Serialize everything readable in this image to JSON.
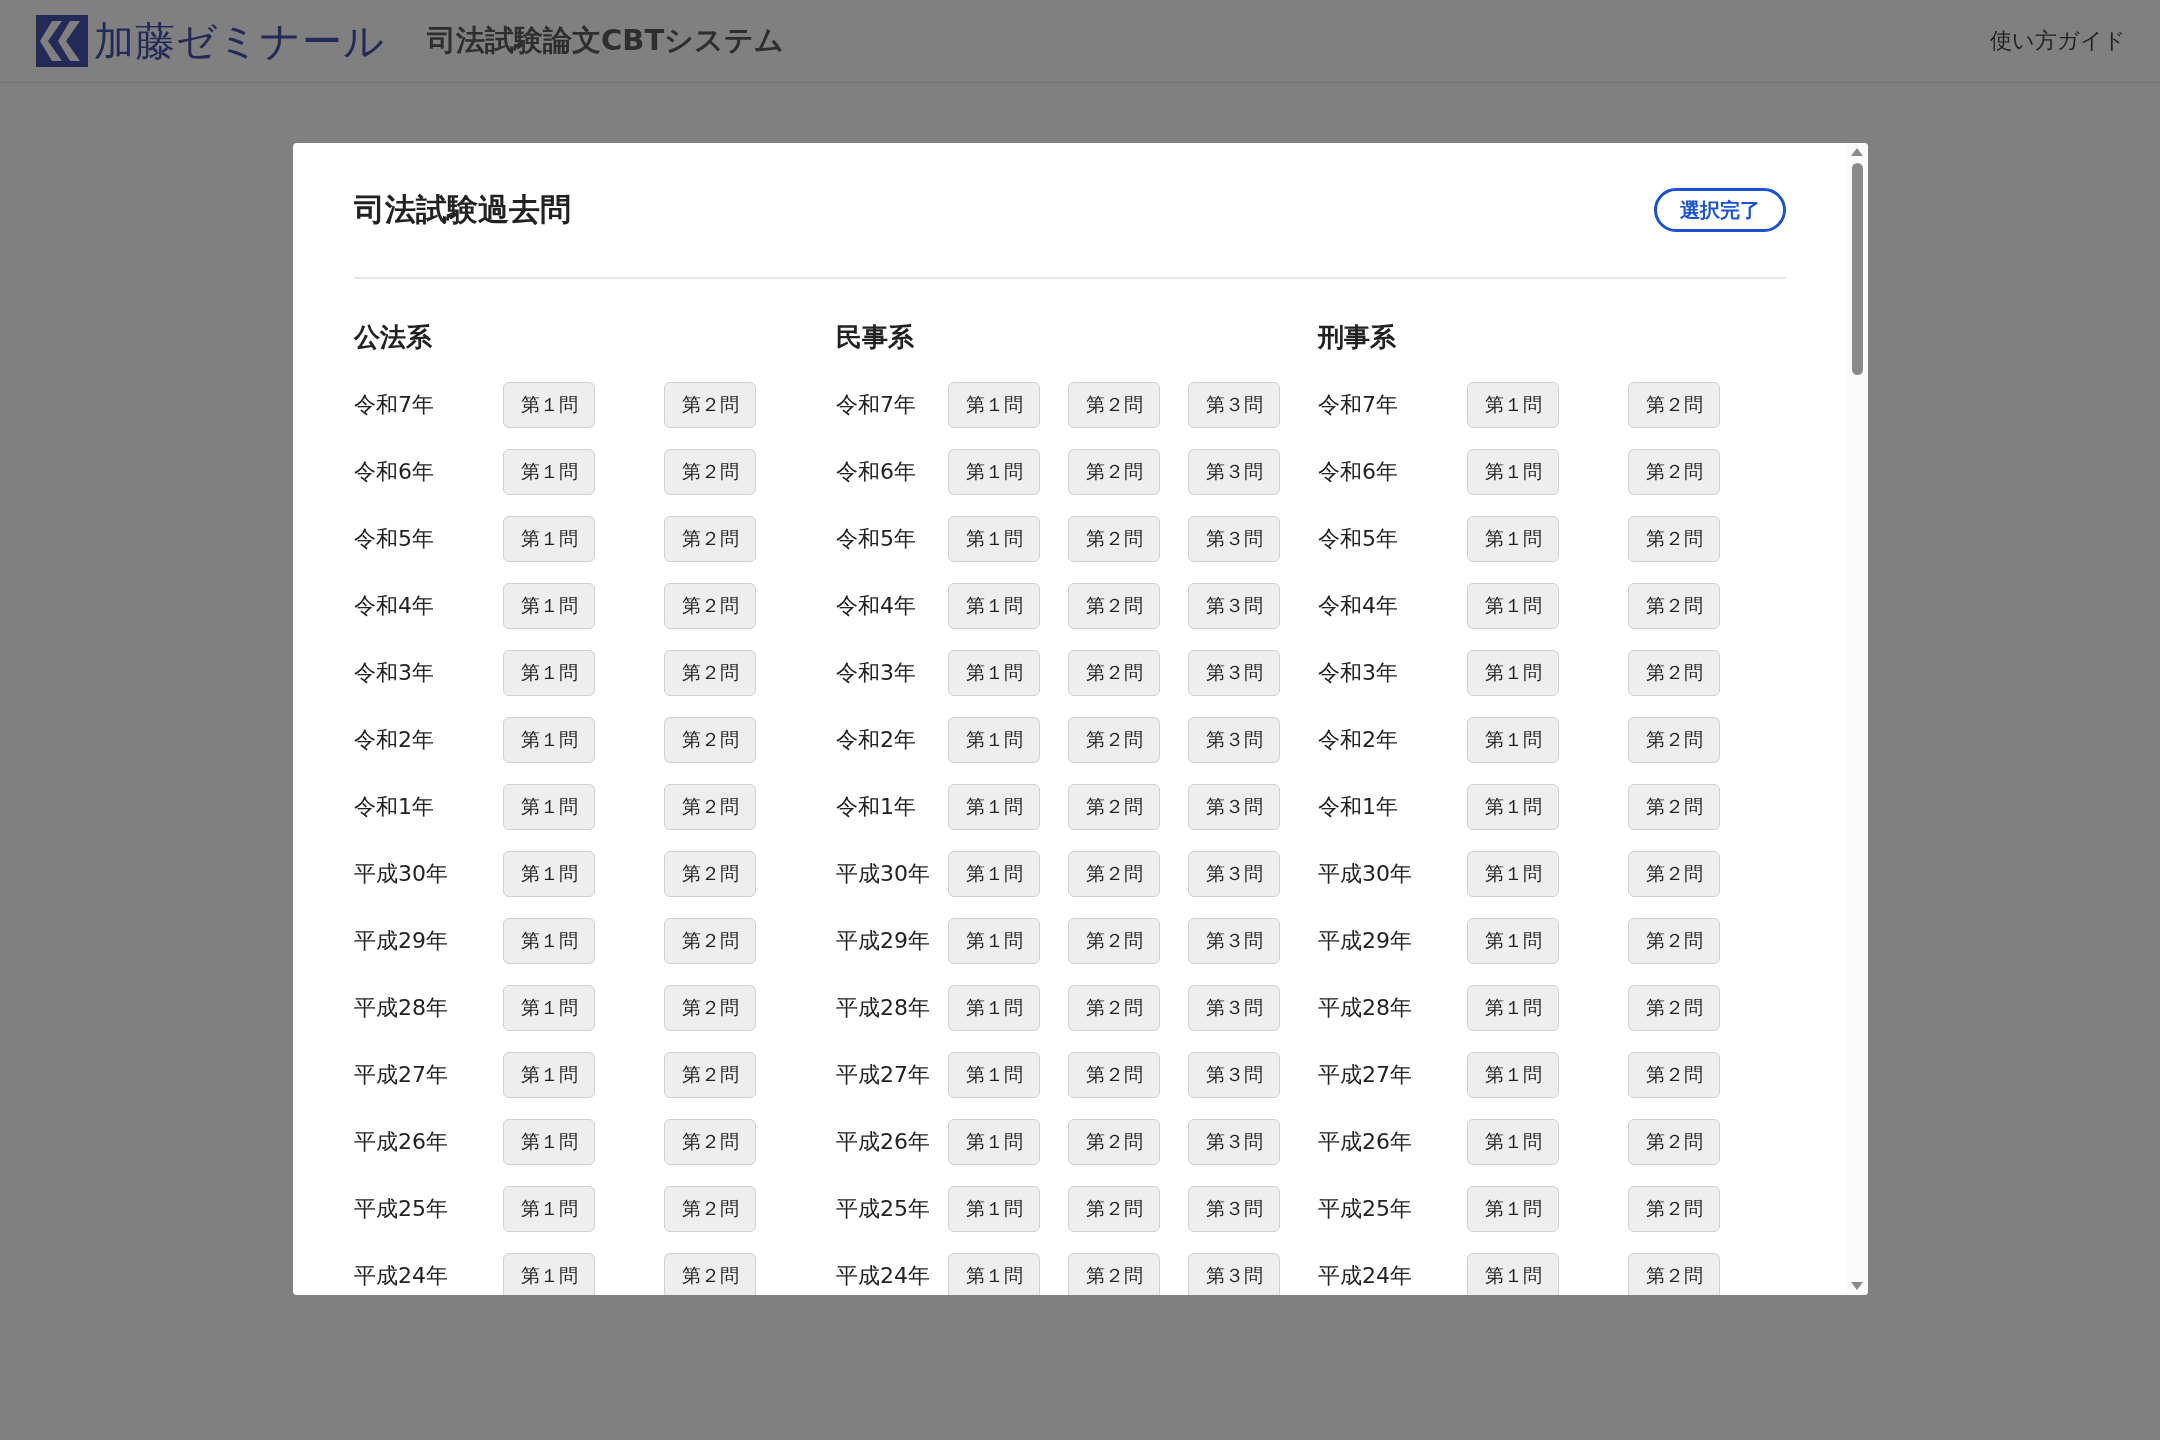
{
  "header": {
    "logo_text": "加藤ゼミナール",
    "title": "司法試験論文CBTシステム",
    "guide_link": "使い方ガイド"
  },
  "dialog": {
    "title": "司法試験過去問",
    "done_button": "選択完了",
    "sections": [
      {
        "heading": "公法系",
        "rows": [
          {
            "year": "令和7年",
            "questions": [
              {
                "label": "第１問",
                "selected": false
              },
              {
                "label": "第２問",
                "selected": false
              }
            ]
          },
          {
            "year": "令和6年",
            "questions": [
              {
                "label": "第１問",
                "selected": false
              },
              {
                "label": "第２問",
                "selected": false
              }
            ]
          },
          {
            "year": "令和5年",
            "questions": [
              {
                "label": "第１問",
                "selected": false
              },
              {
                "label": "第２問",
                "selected": false
              }
            ]
          },
          {
            "year": "令和4年",
            "questions": [
              {
                "label": "第１問",
                "selected": false
              },
              {
                "label": "第２問",
                "selected": false
              }
            ]
          },
          {
            "year": "令和3年",
            "questions": [
              {
                "label": "第１問",
                "selected": false
              },
              {
                "label": "第２問",
                "selected": false
              }
            ]
          },
          {
            "year": "令和2年",
            "questions": [
              {
                "label": "第１問",
                "selected": false
              },
              {
                "label": "第２問",
                "selected": false
              }
            ]
          },
          {
            "year": "令和1年",
            "questions": [
              {
                "label": "第１問",
                "selected": false
              },
              {
                "label": "第２問",
                "selected": false
              }
            ]
          },
          {
            "year": "平成30年",
            "questions": [
              {
                "label": "第１問",
                "selected": false
              },
              {
                "label": "第２問",
                "selected": false
              }
            ]
          },
          {
            "year": "平成29年",
            "questions": [
              {
                "label": "第１問",
                "selected": false
              },
              {
                "label": "第２問",
                "selected": false
              }
            ]
          },
          {
            "year": "平成28年",
            "questions": [
              {
                "label": "第１問",
                "selected": false
              },
              {
                "label": "第２問",
                "selected": false
              }
            ]
          },
          {
            "year": "平成27年",
            "questions": [
              {
                "label": "第１問",
                "selected": false
              },
              {
                "label": "第２問",
                "selected": false
              }
            ]
          },
          {
            "year": "平成26年",
            "questions": [
              {
                "label": "第１問",
                "selected": false
              },
              {
                "label": "第２問",
                "selected": false
              }
            ]
          },
          {
            "year": "平成25年",
            "questions": [
              {
                "label": "第１問",
                "selected": false
              },
              {
                "label": "第２問",
                "selected": false
              }
            ]
          },
          {
            "year": "平成24年",
            "questions": [
              {
                "label": "第１問",
                "selected": false
              },
              {
                "label": "第２問",
                "selected": false
              }
            ]
          }
        ]
      },
      {
        "heading": "民事系",
        "rows": [
          {
            "year": "令和7年",
            "questions": [
              {
                "label": "第１問",
                "selected": false
              },
              {
                "label": "第２問",
                "selected": false
              },
              {
                "label": "第３問",
                "selected": false
              }
            ]
          },
          {
            "year": "令和6年",
            "questions": [
              {
                "label": "第１問",
                "selected": false
              },
              {
                "label": "第２問",
                "selected": false
              },
              {
                "label": "第３問",
                "selected": false
              }
            ]
          },
          {
            "year": "令和5年",
            "questions": [
              {
                "label": "第１問",
                "selected": false
              },
              {
                "label": "第２問",
                "selected": false
              },
              {
                "label": "第３問",
                "selected": false
              }
            ]
          },
          {
            "year": "令和4年",
            "questions": [
              {
                "label": "第１問",
                "selected": false
              },
              {
                "label": "第２問",
                "selected": false
              },
              {
                "label": "第３問",
                "selected": false
              }
            ]
          },
          {
            "year": "令和3年",
            "questions": [
              {
                "label": "第１問",
                "selected": false
              },
              {
                "label": "第２問",
                "selected": false
              },
              {
                "label": "第３問",
                "selected": false
              }
            ]
          },
          {
            "year": "令和2年",
            "questions": [
              {
                "label": "第１問",
                "selected": false
              },
              {
                "label": "第２問",
                "selected": false
              },
              {
                "label": "第３問",
                "selected": false
              }
            ]
          },
          {
            "year": "令和1年",
            "questions": [
              {
                "label": "第１問",
                "selected": false
              },
              {
                "label": "第２問",
                "selected": false
              },
              {
                "label": "第３問",
                "selected": false
              }
            ]
          },
          {
            "year": "平成30年",
            "questions": [
              {
                "label": "第１問",
                "selected": false
              },
              {
                "label": "第２問",
                "selected": false
              },
              {
                "label": "第３問",
                "selected": false
              }
            ]
          },
          {
            "year": "平成29年",
            "questions": [
              {
                "label": "第１問",
                "selected": false
              },
              {
                "label": "第２問",
                "selected": false
              },
              {
                "label": "第３問",
                "selected": false
              }
            ]
          },
          {
            "year": "平成28年",
            "questions": [
              {
                "label": "第１問",
                "selected": false
              },
              {
                "label": "第２問",
                "selected": false
              },
              {
                "label": "第３問",
                "selected": false
              }
            ]
          },
          {
            "year": "平成27年",
            "questions": [
              {
                "label": "第１問",
                "selected": false
              },
              {
                "label": "第２問",
                "selected": false
              },
              {
                "label": "第３問",
                "selected": false
              }
            ]
          },
          {
            "year": "平成26年",
            "questions": [
              {
                "label": "第１問",
                "selected": false
              },
              {
                "label": "第２問",
                "selected": false
              },
              {
                "label": "第３問",
                "selected": false
              }
            ]
          },
          {
            "year": "平成25年",
            "questions": [
              {
                "label": "第１問",
                "selected": false
              },
              {
                "label": "第２問",
                "selected": false
              },
              {
                "label": "第３問",
                "selected": false
              }
            ]
          },
          {
            "year": "平成24年",
            "questions": [
              {
                "label": "第１問",
                "selected": false
              },
              {
                "label": "第２問",
                "selected": false
              },
              {
                "label": "第３問",
                "selected": false
              }
            ]
          }
        ]
      },
      {
        "heading": "刑事系",
        "rows": [
          {
            "year": "令和7年",
            "questions": [
              {
                "label": "第１問",
                "selected": false
              },
              {
                "label": "第２問",
                "selected": false
              }
            ]
          },
          {
            "year": "令和6年",
            "questions": [
              {
                "label": "第１問",
                "selected": false
              },
              {
                "label": "第２問",
                "selected": false
              }
            ]
          },
          {
            "year": "令和5年",
            "questions": [
              {
                "label": "第１問",
                "selected": false
              },
              {
                "label": "第２問",
                "selected": false
              }
            ]
          },
          {
            "year": "令和4年",
            "questions": [
              {
                "label": "第１問",
                "selected": false
              },
              {
                "label": "第２問",
                "selected": false
              }
            ]
          },
          {
            "year": "令和3年",
            "questions": [
              {
                "label": "第１問",
                "selected": false
              },
              {
                "label": "第２問",
                "selected": false
              }
            ]
          },
          {
            "year": "令和2年",
            "questions": [
              {
                "label": "第１問",
                "selected": false
              },
              {
                "label": "第２問",
                "selected": false
              }
            ]
          },
          {
            "year": "令和1年",
            "questions": [
              {
                "label": "第１問",
                "selected": false
              },
              {
                "label": "第２問",
                "selected": false
              }
            ]
          },
          {
            "year": "平成30年",
            "questions": [
              {
                "label": "第１問",
                "selected": false
              },
              {
                "label": "第２問",
                "selected": false
              }
            ]
          },
          {
            "year": "平成29年",
            "questions": [
              {
                "label": "第１問",
                "selected": false
              },
              {
                "label": "第２問",
                "selected": false
              }
            ]
          },
          {
            "year": "平成28年",
            "questions": [
              {
                "label": "第１問",
                "selected": false
              },
              {
                "label": "第２問",
                "selected": false
              }
            ]
          },
          {
            "year": "平成27年",
            "questions": [
              {
                "label": "第１問",
                "selected": false
              },
              {
                "label": "第２問",
                "selected": false
              }
            ]
          },
          {
            "year": "平成26年",
            "questions": [
              {
                "label": "第１問",
                "selected": false
              },
              {
                "label": "第２問",
                "selected": false
              }
            ]
          },
          {
            "year": "平成25年",
            "questions": [
              {
                "label": "第１問",
                "selected": false
              },
              {
                "label": "第２問",
                "selected": false
              }
            ]
          },
          {
            "year": "平成24年",
            "questions": [
              {
                "label": "第１問",
                "selected": false
              },
              {
                "label": "第２問",
                "selected": false
              }
            ]
          }
        ]
      }
    ]
  }
}
